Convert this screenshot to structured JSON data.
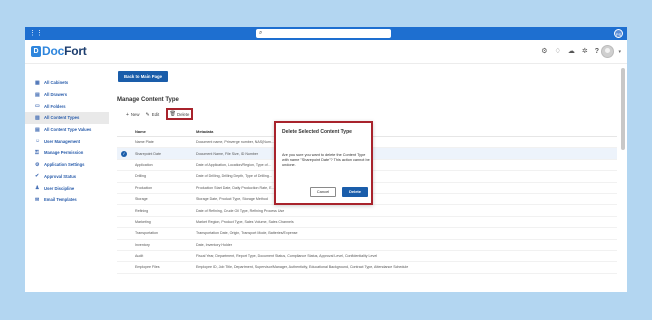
{
  "topbar": {
    "search_icon": "search-icon",
    "avatar_initials": "PS"
  },
  "logo": {
    "mark": "D",
    "part1": "Doc",
    "part2": "Fort"
  },
  "header_icons": {
    "settings": "⚙",
    "notifications": "♢",
    "cloud": "☁",
    "sync": "✲",
    "help": "?"
  },
  "sidebar": {
    "items": [
      {
        "icon": "▦",
        "label": "All Cabinets"
      },
      {
        "icon": "▤",
        "label": "All Drawers"
      },
      {
        "icon": "▭",
        "label": "All Folders"
      },
      {
        "icon": "▧",
        "label": "All Content Types"
      },
      {
        "icon": "▤",
        "label": "All Content Type Values"
      },
      {
        "icon": "☺",
        "label": "User Management"
      },
      {
        "icon": "⚿",
        "label": "Manage Permission"
      },
      {
        "icon": "⚙",
        "label": "Application Settings"
      },
      {
        "icon": "✔",
        "label": "Approval Status"
      },
      {
        "icon": "♟",
        "label": "User Discipline"
      },
      {
        "icon": "✉",
        "label": "Email Templates"
      }
    ]
  },
  "main": {
    "back_button": "Back to Main Page",
    "title": "Manage Content Type",
    "toolbar": {
      "new": "New",
      "edit": "Edit",
      "delete": "Delete"
    },
    "table": {
      "headers": [
        "Name",
        "Metadata"
      ],
      "rows": [
        {
          "name": "Name Plate",
          "meta": "Document name, Prinverge number, NAS(Num..."
        },
        {
          "name": "Sharepoint Date",
          "meta": "Document Name, File Size, ID Number"
        },
        {
          "name": "Application",
          "meta": "Date of Application, Location/Region, Type of..."
        },
        {
          "name": "Drilling",
          "meta": "Date of Drilling, Drilling Depth, Type of Drilling..."
        },
        {
          "name": "Production",
          "meta": "Production Start Date, Daily Production Rate, E..."
        },
        {
          "name": "Storage",
          "meta": "Storage Date, Product Type, Storage Method"
        },
        {
          "name": "Refining",
          "meta": "Date of Refining, Crude Oil Type, Refining Process Use"
        },
        {
          "name": "Marketing",
          "meta": "Market Region, Product Type, Sales Volume, Sales Channels"
        },
        {
          "name": "Transportation",
          "meta": "Transportation Date, Origin, Transport Mode, Batteries/Expense"
        },
        {
          "name": "Inventory",
          "meta": "Date, Inventory Holder"
        },
        {
          "name": "Audit",
          "meta": "Fiscal Year, Department, Report Type, Document Status, Compliance Status, Approval Level, Confidentiality Level"
        },
        {
          "name": "Employee Files",
          "meta": "Employee ID, Job Title, Department, Supervisor/Manager, Authenticity, Educational Background, Contract Type, Attendance Schedule"
        }
      ]
    }
  },
  "dialog": {
    "title": "Delete Selected Content Type",
    "message": "Are you sure you want to delete the Content Type with name \"Sharepoint Date\"? This action cannot be undone.",
    "cancel": "Cancel",
    "delete": "Delete"
  }
}
